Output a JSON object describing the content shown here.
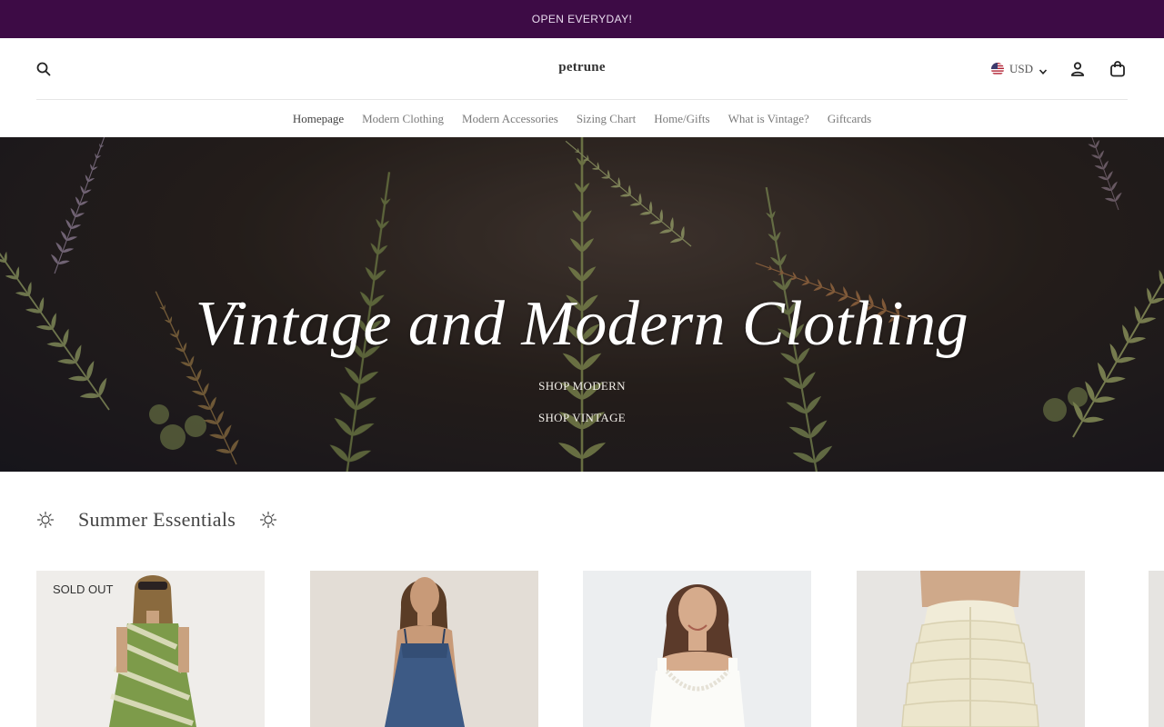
{
  "announcement": {
    "text": "OPEN EVERYDAY!"
  },
  "header": {
    "logo": "petrune",
    "currency": "USD",
    "icons": {
      "search": "search-icon",
      "account": "user-icon",
      "cart": "bag-icon",
      "currency_dropdown": "chevron-down-icon",
      "flag": "us-flag-icon"
    }
  },
  "nav": {
    "items": [
      {
        "label": "Homepage"
      },
      {
        "label": "Modern Clothing"
      },
      {
        "label": "Modern Accessories"
      },
      {
        "label": "Sizing Chart"
      },
      {
        "label": "Home/Gifts"
      },
      {
        "label": "What is Vintage?"
      },
      {
        "label": "Giftcards"
      }
    ]
  },
  "hero": {
    "title": "Vintage and Modern Clothing",
    "links": [
      {
        "label": "SHOP MODERN"
      },
      {
        "label": "SHOP VINTAGE"
      }
    ]
  },
  "collection": {
    "title": "Summer Essentials",
    "decoration_icon": "sun-icon",
    "products": [
      {
        "badge": "SOLD OUT",
        "image": "green-striped-dress"
      },
      {
        "image": "denim-slip-dress"
      },
      {
        "image": "white-lace-top"
      },
      {
        "image": "ruffle-bloomers"
      }
    ]
  },
  "colors": {
    "announcement_bg": "#3d0b45",
    "announcement_text": "#e9dcef",
    "hero_text": "#ffffff"
  }
}
